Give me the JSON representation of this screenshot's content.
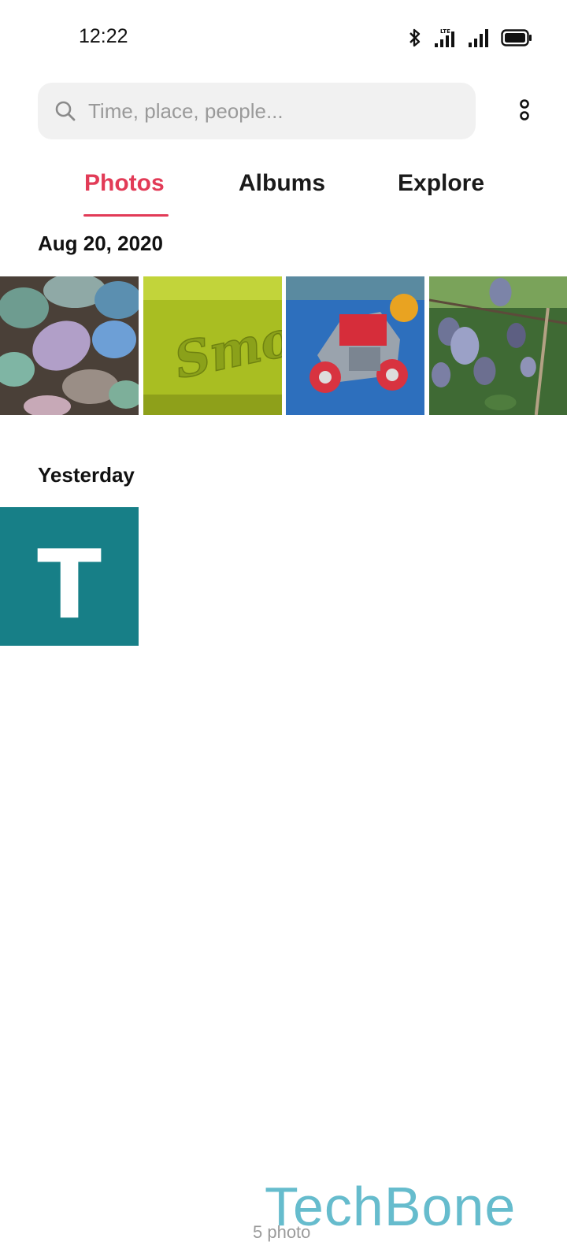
{
  "status_bar": {
    "time": "12:22",
    "icons": [
      "bluetooth-icon",
      "lte-signal-icon",
      "cell-signal-icon",
      "battery-icon"
    ],
    "network_label": "LTE"
  },
  "search": {
    "placeholder": "Time, place, people...",
    "value": ""
  },
  "tabs": [
    {
      "label": "Photos",
      "active": true
    },
    {
      "label": "Albums",
      "active": false
    },
    {
      "label": "Explore",
      "active": false
    }
  ],
  "sections": [
    {
      "header": "Aug 20, 2020",
      "photos": [
        {
          "name": "chalk-photo"
        },
        {
          "name": "smoby-toy-photo",
          "text": "Smoby"
        },
        {
          "name": "toy-car-photo"
        },
        {
          "name": "plums-photo"
        }
      ]
    },
    {
      "header": "Yesterday",
      "photos": [
        {
          "name": "t-logo-photo",
          "text": "T"
        }
      ]
    }
  ],
  "footer": {
    "photo_count": "5 photo"
  },
  "watermark": "TechBone",
  "colors": {
    "accent": "#e23b57",
    "search_bg": "#f1f1f1",
    "teal_tile": "#177f87",
    "watermark": "#66bccd"
  }
}
